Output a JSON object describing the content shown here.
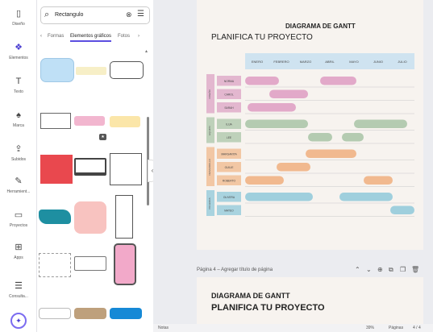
{
  "rail": [
    {
      "label": "Diseño",
      "icon": "layout-icon",
      "glyph": "▯"
    },
    {
      "label": "Elementos",
      "icon": "elements-icon",
      "glyph": "❖"
    },
    {
      "label": "Texto",
      "icon": "text-icon",
      "glyph": "T"
    },
    {
      "label": "Marca",
      "icon": "brand-icon",
      "glyph": "♠"
    },
    {
      "label": "Subidos",
      "icon": "upload-icon",
      "glyph": "⇪"
    },
    {
      "label": "Herramient...",
      "icon": "draw-icon",
      "glyph": "✎"
    },
    {
      "label": "Proyectos",
      "icon": "folder-icon",
      "glyph": "▭"
    },
    {
      "label": "Apps",
      "icon": "apps-icon",
      "glyph": "⊞"
    },
    {
      "label": "Consulta...",
      "icon": "list-icon",
      "glyph": "☰"
    }
  ],
  "search": {
    "value": "Rectangulo"
  },
  "tabs": {
    "prev": "‹",
    "t1": "Formas",
    "t2": "Elementos gráficos",
    "t3": "Fotos",
    "next": "›"
  },
  "gantt": {
    "title": "DIAGRAMA DE GANTT",
    "subtitle": "PLANIFICA TU PROYECTO",
    "months": [
      "ENERO",
      "FEBRERO",
      "MARZO",
      "ABRIL",
      "MAYO",
      "JUNIO",
      "JULIO"
    ],
    "groups": [
      {
        "name": "DISEÑO",
        "color": "#e3b7cf",
        "bar": "#e2a9c9",
        "tasks": [
          {
            "name": "NORMA",
            "bars": [
              [
                0,
                1.4
              ],
              [
                3.1,
                4.6
              ]
            ]
          },
          {
            "name": "CAROL",
            "bars": [
              [
                1.0,
                2.6
              ]
            ]
          },
          {
            "name": "SARAH",
            "bars": [
              [
                0.1,
                2.1
              ]
            ]
          }
        ]
      },
      {
        "name": "EQUIPO",
        "color": "#bed1ba",
        "bar": "#b4cbb1",
        "tasks": [
          {
            "name": "ILIJA",
            "bars": [
              [
                0,
                2.6
              ],
              [
                4.5,
                6.7
              ]
            ]
          },
          {
            "name": "LEE",
            "bars": [
              [
                2.6,
                3.6
              ],
              [
                4.0,
                4.9
              ]
            ]
          }
        ]
      },
      {
        "name": "DESARROLLO",
        "color": "#f2c7a4",
        "bar": "#f1b98f",
        "tasks": [
          {
            "name": "MARGARITA",
            "bars": [
              [
                2.5,
                4.6
              ]
            ]
          },
          {
            "name": "GUILIE",
            "bars": [
              [
                1.3,
                2.7
              ]
            ]
          },
          {
            "name": "ROBERTO",
            "bars": [
              [
                0,
                1.6
              ],
              [
                4.9,
                6.1
              ]
            ]
          }
        ]
      },
      {
        "name": "PRUEBAS",
        "color": "#a9d3df",
        "bar": "#9fcfdd",
        "tasks": [
          {
            "name": "OLIVERA",
            "bars": [
              [
                0,
                2.8
              ],
              [
                3.9,
                6.1
              ]
            ]
          },
          {
            "name": "MATEO",
            "bars": [
              [
                6.0,
                7.0
              ]
            ]
          }
        ]
      }
    ]
  },
  "pagebar": {
    "label": "Página 4 – Agregar título de página"
  },
  "page2": {
    "title": "DIAGRAMA DE GANTT",
    "subtitle": "PLANIFICA TU PROYECTO"
  },
  "bottombar": {
    "notes": "Notas",
    "zoom": "39%",
    "pages": "Páginas",
    "pagecount": "4 / 4"
  }
}
